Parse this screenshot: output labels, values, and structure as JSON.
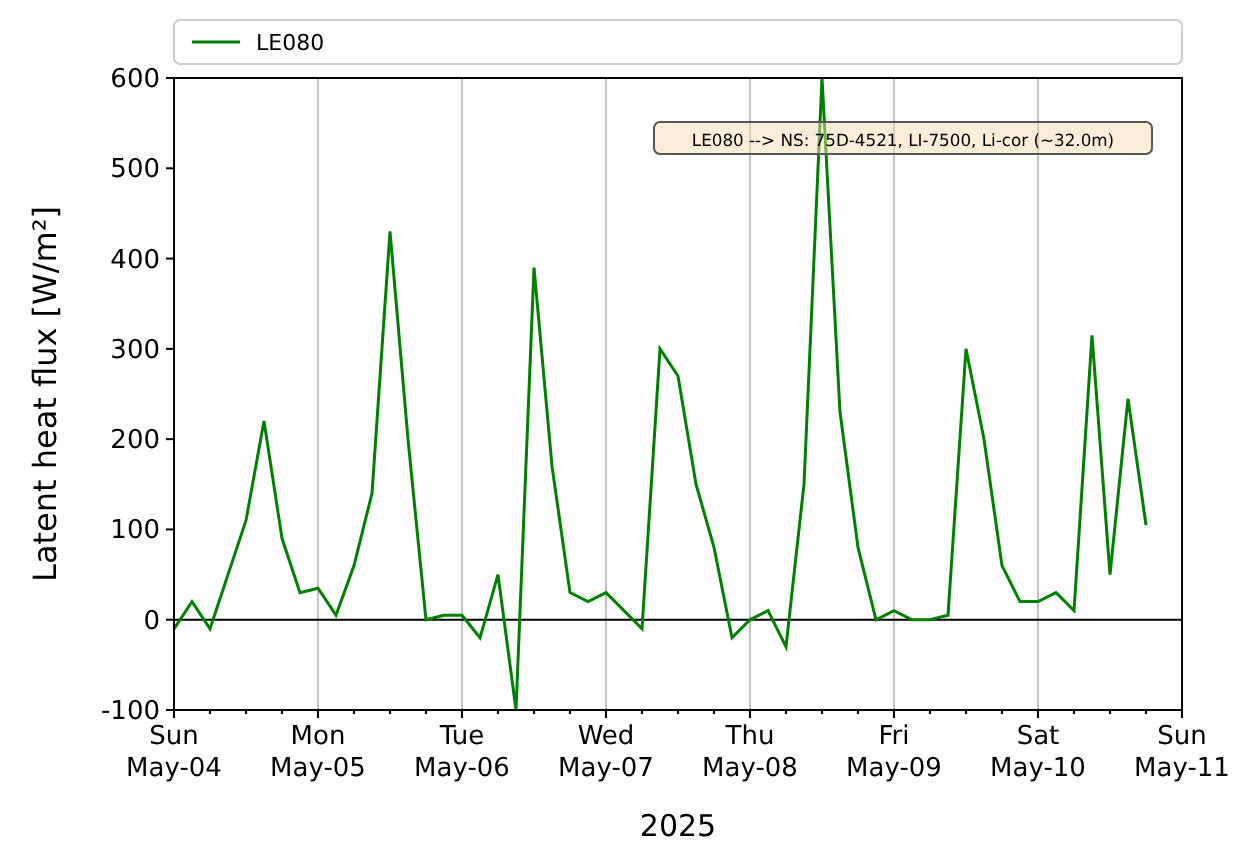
{
  "chart_data": {
    "type": "line",
    "xlabel": "2025",
    "ylabel": "Latent heat flux [W/m²]",
    "categories": [
      "Sun May-04",
      null,
      null,
      null,
      null,
      null,
      null,
      null,
      "Mon May-05",
      null,
      null,
      null,
      null,
      null,
      null,
      null,
      "Tue May-06",
      null,
      null,
      null,
      null,
      null,
      null,
      null,
      "Wed May-07",
      null,
      null,
      null,
      null,
      null,
      null,
      null,
      "Thu May-08",
      null,
      null,
      null,
      null,
      null,
      null,
      null,
      "Fri May-09",
      null,
      null,
      null,
      null,
      null,
      null,
      null,
      "Sat May-10",
      null,
      null,
      null,
      null,
      null,
      null,
      null,
      "Sun May-11"
    ],
    "series": [
      {
        "name": "LE080",
        "color": "#008000",
        "values": [
          -10,
          20,
          -10,
          50,
          110,
          220,
          90,
          30,
          35,
          5,
          60,
          140,
          430,
          200,
          0,
          5,
          5,
          -20,
          50,
          -100,
          390,
          170,
          30,
          20,
          30,
          10,
          -10,
          300,
          270,
          150,
          80,
          -20,
          0,
          10,
          -30,
          150,
          600,
          230,
          80,
          0,
          10,
          0,
          0,
          5,
          300,
          200,
          60,
          20,
          20,
          30,
          10,
          315,
          50,
          245,
          105,
          null,
          null
        ]
      }
    ],
    "grid": true,
    "ylim": [
      -100,
      600
    ],
    "yticks": [
      -100,
      0,
      100,
      200,
      300,
      400,
      500,
      600
    ],
    "annotations": [
      {
        "text": "LE080 --> NS: 75D-4521, LI-7500, Li-cor (~32.0m)"
      }
    ]
  }
}
